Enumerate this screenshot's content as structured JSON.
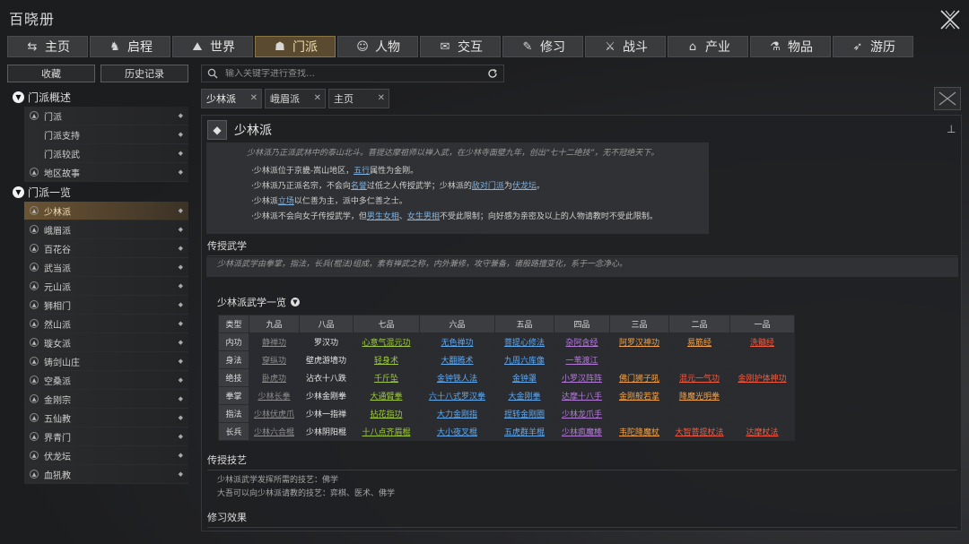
{
  "app": {
    "title": "百晓册"
  },
  "nav": [
    {
      "label": "主页",
      "icon": "home-icon",
      "glyph": "⇆",
      "active": false
    },
    {
      "label": "启程",
      "icon": "horse-icon",
      "glyph": "♞",
      "active": false
    },
    {
      "label": "世界",
      "icon": "mountain-icon",
      "glyph": "⛰",
      "active": false
    },
    {
      "label": "门派",
      "icon": "sect-icon",
      "glyph": "☗",
      "active": true
    },
    {
      "label": "人物",
      "icon": "person-icon",
      "glyph": "☺",
      "active": false
    },
    {
      "label": "交互",
      "icon": "chat-icon",
      "glyph": "✉",
      "active": false
    },
    {
      "label": "修习",
      "icon": "book-icon",
      "glyph": "✎",
      "active": false
    },
    {
      "label": "战斗",
      "icon": "swords-icon",
      "glyph": "⚔",
      "active": false
    },
    {
      "label": "产业",
      "icon": "building-icon",
      "glyph": "⌂",
      "active": false
    },
    {
      "label": "物品",
      "icon": "item-icon",
      "glyph": "⚗",
      "active": false
    },
    {
      "label": "游历",
      "icon": "travel-icon",
      "glyph": "➶",
      "active": false
    }
  ],
  "sidebar": {
    "favorites_label": "收藏",
    "history_label": "历史记录",
    "groups": [
      {
        "label": "门派概述",
        "items": [
          {
            "label": "门派",
            "sub": false,
            "sel": false
          },
          {
            "label": "门派支持",
            "sub": true,
            "sel": false
          },
          {
            "label": "门派较武",
            "sub": true,
            "sel": false
          },
          {
            "label": "地区故事",
            "sub": false,
            "sel": false
          }
        ]
      },
      {
        "label": "门派一览",
        "items": [
          {
            "label": "少林派",
            "sub": false,
            "sel": true
          },
          {
            "label": "峨眉派",
            "sub": false,
            "sel": false
          },
          {
            "label": "百花谷",
            "sub": false,
            "sel": false
          },
          {
            "label": "武当派",
            "sub": false,
            "sel": false
          },
          {
            "label": "元山派",
            "sub": false,
            "sel": false
          },
          {
            "label": "狮相门",
            "sub": false,
            "sel": false
          },
          {
            "label": "然山派",
            "sub": false,
            "sel": false
          },
          {
            "label": "璇女派",
            "sub": false,
            "sel": false
          },
          {
            "label": "铸剑山庄",
            "sub": false,
            "sel": false
          },
          {
            "label": "空桑派",
            "sub": false,
            "sel": false
          },
          {
            "label": "金刚宗",
            "sub": false,
            "sel": false
          },
          {
            "label": "五仙教",
            "sub": false,
            "sel": false
          },
          {
            "label": "界青门",
            "sub": false,
            "sel": false
          },
          {
            "label": "伏龙坛",
            "sub": false,
            "sel": false
          },
          {
            "label": "血犼教",
            "sub": false,
            "sel": false
          }
        ]
      }
    ]
  },
  "search": {
    "placeholder": "输入关键字进行查找…"
  },
  "content_tabs": [
    {
      "label": "少林派",
      "active": true
    },
    {
      "label": "峨眉派",
      "active": false
    },
    {
      "label": "主页",
      "active": false
    }
  ],
  "page": {
    "title": "少林派",
    "intro": "少林派乃正派武林中的泰山北斗。菩提达摩祖师以禅入武，在少林寺面壁九年，创出“七十二绝技”，无不冠绝天下。",
    "bullets": [
      [
        {
          "t": "·少林派位于京畿-嵩山地区，"
        },
        {
          "t": "五行",
          "l": true
        },
        {
          "t": "属性为金刚。"
        }
      ],
      [
        {
          "t": "·少林派乃正派名宗，不会向"
        },
        {
          "t": "名誉",
          "l": true
        },
        {
          "t": "过低之人传授武学；少林派的"
        },
        {
          "t": "敌对门派",
          "l": true
        },
        {
          "t": "为"
        },
        {
          "t": "伏龙坛",
          "l": true
        },
        {
          "t": "。"
        }
      ],
      [
        {
          "t": "·少林派"
        },
        {
          "t": "立场",
          "l": true
        },
        {
          "t": "以仁善为主，派中多仁善之士。"
        }
      ],
      [
        {
          "t": "·少林派不会向女子传授武学，但"
        },
        {
          "t": "男生女相",
          "l": true
        },
        {
          "t": "、"
        },
        {
          "t": "女生男相",
          "l": true
        },
        {
          "t": "不受此限制；向好感为亲密及以上的人物请教时不受此限制。"
        }
      ]
    ],
    "martial_heading": "传授武学",
    "martial_desc": "少林派武学由拳掌，指法，长兵(棍法)组成，素有禅武之称，内外兼修，攻守兼备，诸般路擅变化，系于一念净心。",
    "martial_list_title": "少林派武学一览",
    "table": {
      "corner": "类型",
      "grades": [
        "九品",
        "八品",
        "七品",
        "六品",
        "五品",
        "四品",
        "三品",
        "二品",
        "一品"
      ],
      "rows": [
        {
          "type": "内功",
          "cells": [
            [
              "静禅功",
              "grey"
            ],
            [
              "罗汉功",
              "white"
            ],
            [
              "心意气混元功",
              "green"
            ],
            [
              "无色禅功",
              "blue"
            ],
            [
              "菩提心修法",
              "blue"
            ],
            [
              "杂阿含经",
              "purple"
            ],
            [
              "阿罗汉神功",
              "orange"
            ],
            [
              "易筋经",
              "orange"
            ],
            [
              "洗髓经",
              "red"
            ]
          ]
        },
        {
          "type": "身法",
          "cells": [
            [
              "穿纵功",
              "grey"
            ],
            [
              "壁虎游墙功",
              "white"
            ],
            [
              "轻身术",
              "green"
            ],
            [
              "大翻腾术",
              "blue"
            ],
            [
              "九周六库像",
              "blue"
            ],
            [
              "一苇渡江",
              "purple"
            ],
            [
              "",
              ""
            ],
            [
              "",
              ""
            ],
            [
              "",
              ""
            ]
          ]
        },
        {
          "type": "绝技",
          "cells": [
            [
              "卧虎功",
              "grey"
            ],
            [
              "沾衣十八跌",
              "white"
            ],
            [
              "千斤坠",
              "green"
            ],
            [
              "金钟铁人法",
              "blue"
            ],
            [
              "金钟罩",
              "blue"
            ],
            [
              "小罗汉阵阵",
              "purple"
            ],
            [
              "佛门狮子吼",
              "orange"
            ],
            [
              "混元一气功",
              "red"
            ],
            [
              "金刚护体神功",
              "red"
            ]
          ]
        },
        {
          "type": "拳掌",
          "cells": [
            [
              "少林长拳",
              "grey"
            ],
            [
              "少林金刚拳",
              "white"
            ],
            [
              "大通臂拳",
              "green"
            ],
            [
              "六十八式罗汉拳",
              "blue"
            ],
            [
              "大金刚拳",
              "blue"
            ],
            [
              "达摩十八手",
              "purple"
            ],
            [
              "金刚般若掌",
              "orange"
            ],
            [
              "降魔光明拳",
              "orange"
            ],
            [
              "",
              ""
            ]
          ]
        },
        {
          "type": "指法",
          "cells": [
            [
              "少林伏虎爪",
              "grey"
            ],
            [
              "少林一指禅",
              "white"
            ],
            [
              "拈花指功",
              "green"
            ],
            [
              "大力金刚指",
              "blue"
            ],
            [
              "捏转金刚圈",
              "blue"
            ],
            [
              "少林龙爪手",
              "purple"
            ],
            [
              "",
              ""
            ],
            [
              "",
              ""
            ],
            [
              "",
              ""
            ]
          ]
        },
        {
          "type": "长兵",
          "cells": [
            [
              "少林六合棍",
              "grey"
            ],
            [
              "少林阴阳棍",
              "white"
            ],
            [
              "十八点齐眉棍",
              "green"
            ],
            [
              "大小夜叉棍",
              "blue"
            ],
            [
              "五虎群羊棍",
              "blue"
            ],
            [
              "少林疯魔棒",
              "purple"
            ],
            [
              "韦陀降魔杖",
              "orange"
            ],
            [
              "大智菩提杖法",
              "red"
            ],
            [
              "达摩杖法",
              "red"
            ]
          ]
        }
      ]
    },
    "skills_heading": "传授技艺",
    "skills_lines": [
      "少林派武学发挥所需的技艺：佛学",
      "大吾可以向少林派请教的技艺：弈棋、医术、佛学"
    ],
    "effects_heading": "修习效果"
  },
  "colors": {
    "accent": "#8b7448",
    "active_tab": "#5a4a30"
  }
}
